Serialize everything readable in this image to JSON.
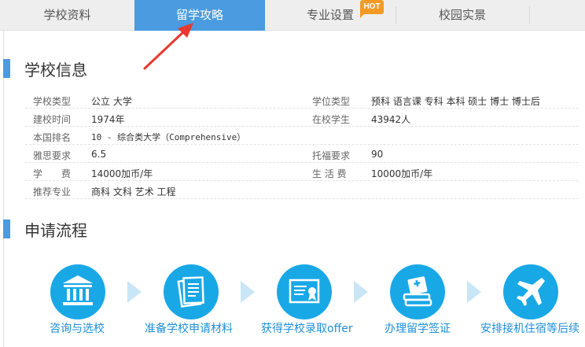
{
  "tabs": [
    {
      "label": "学校资料"
    },
    {
      "label": "留学攻略",
      "active": true
    },
    {
      "label": "专业设置",
      "badge": "HOT"
    },
    {
      "label": "校园实景"
    }
  ],
  "colors": {
    "accent": "#4a9be0",
    "hot": "#f39a25",
    "step": "#19a8e6",
    "arrow": "#e8392f"
  },
  "school_info": {
    "title": "学校信息",
    "rows": [
      {
        "label": "学校类型",
        "value": "公立 大学",
        "label2": "学位类型",
        "value2": "预科 语言课 专科 本科 硕士 博士 博士后"
      },
      {
        "label": "建校时间",
        "value": "1974年",
        "label2": "在校学生",
        "value2": "43942人"
      },
      {
        "label": "本国排名",
        "value": "10 - 综合类大学（Comprehensive）"
      },
      {
        "label": "雅思要求",
        "value": "6.5",
        "label2": "托福要求",
        "value2": "90"
      },
      {
        "label": "学　　费",
        "value": "14000加币/年",
        "label2": "生 活 费",
        "value2": "10000加币/年"
      },
      {
        "label": "推荐专业",
        "value": "商科 文科 艺术 工程"
      }
    ]
  },
  "process": {
    "title": "申请流程",
    "steps": [
      {
        "label": "咨询与选校",
        "icon": "school-building-icon"
      },
      {
        "label": "准备学校申请材料",
        "icon": "documents-icon"
      },
      {
        "label": "获得学校录取offer",
        "icon": "certificate-icon"
      },
      {
        "label": "办理留学签证",
        "icon": "passport-books-icon"
      },
      {
        "label": "安排接机住宿等后续",
        "icon": "airplane-icon"
      }
    ]
  }
}
